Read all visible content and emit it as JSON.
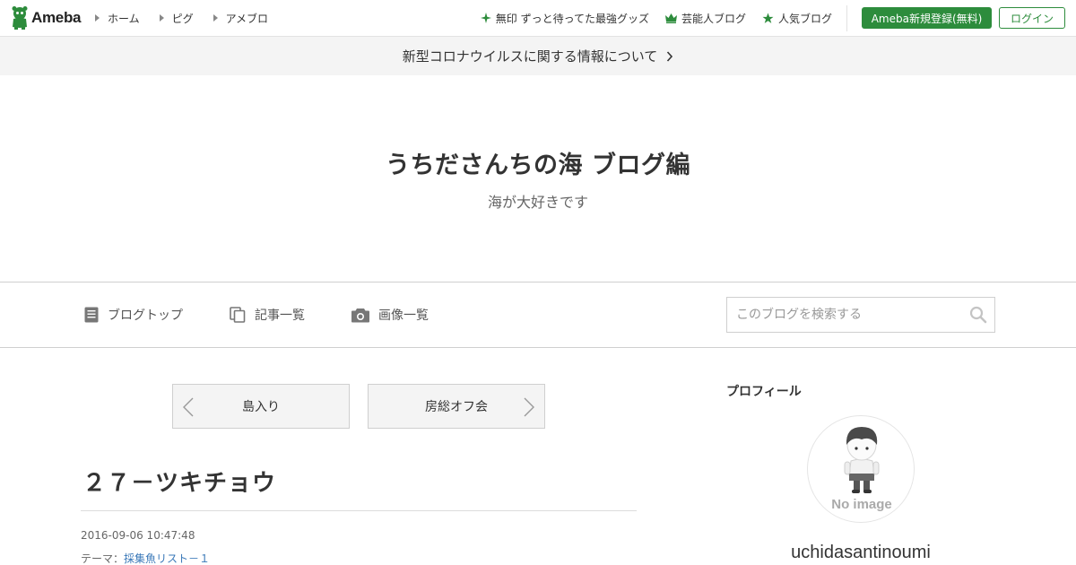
{
  "header": {
    "logo_text": "Ameba",
    "nav": [
      {
        "label": "ホーム"
      },
      {
        "label": "ピグ"
      },
      {
        "label": "アメブロ"
      }
    ],
    "links": [
      {
        "label": "無印 ずっと待ってた最強グッズ",
        "icon": "sparkle-icon"
      },
      {
        "label": "芸能人ブログ",
        "icon": "crown-icon"
      },
      {
        "label": "人気ブログ",
        "icon": "star-icon"
      }
    ],
    "register_label": "Ameba新規登録(無料)",
    "login_label": "ログイン"
  },
  "info_banner": {
    "text": "新型コロナウイルスに関する情報について"
  },
  "blog": {
    "title": "うちださんちの海 ブログ編",
    "description": "海が大好きです"
  },
  "blog_nav": {
    "items": [
      {
        "label": "ブログトップ",
        "icon": "document-icon"
      },
      {
        "label": "記事一覧",
        "icon": "copy-icon"
      },
      {
        "label": "画像一覧",
        "icon": "camera-icon"
      }
    ],
    "search_placeholder": "このブログを検索する"
  },
  "pager": {
    "prev_label": "島入り",
    "next_label": "房総オフ会"
  },
  "article": {
    "title": "２７－ツキチョウ",
    "date": "2016-09-06 10:47:48",
    "theme_prefix": "テーマ：",
    "theme_link": "採集魚リスト－１"
  },
  "sidebar": {
    "heading": "プロフィール",
    "avatar_text": "No image",
    "profile_name": "uchidasantinoumi"
  },
  "colors": {
    "brand_green": "#2d8c3c",
    "link_blue": "#3a78b8"
  }
}
